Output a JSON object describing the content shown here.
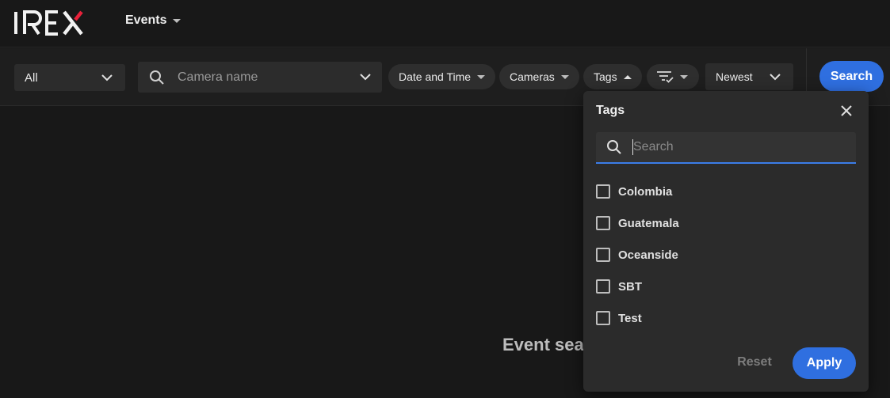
{
  "app": {
    "logo_text": "IREX",
    "nav_label": "Events"
  },
  "filters": {
    "scope_value": "All",
    "camera_placeholder": "Camera name",
    "date_label": "Date and Time",
    "cameras_label": "Cameras",
    "tags_label": "Tags",
    "sort_value": "Newest",
    "search_label": "Search"
  },
  "main": {
    "empty_message": "Event sea"
  },
  "tags_popover": {
    "title": "Tags",
    "search_placeholder": "Search",
    "items": [
      {
        "label": "Colombia",
        "checked": false
      },
      {
        "label": "Guatemala",
        "checked": false
      },
      {
        "label": "Oceanside",
        "checked": false
      },
      {
        "label": "SBT",
        "checked": false
      },
      {
        "label": "Test",
        "checked": false
      }
    ],
    "reset_label": "Reset",
    "apply_label": "Apply"
  },
  "colors": {
    "accent": "#2f6fe0",
    "logo_accent": "#e8213a",
    "background": "#181818",
    "popover": "#2b2b2b"
  },
  "icons": [
    "search-icon",
    "chevron-down-icon",
    "filter-icon",
    "close-icon",
    "caret-down-icon",
    "caret-up-icon"
  ]
}
